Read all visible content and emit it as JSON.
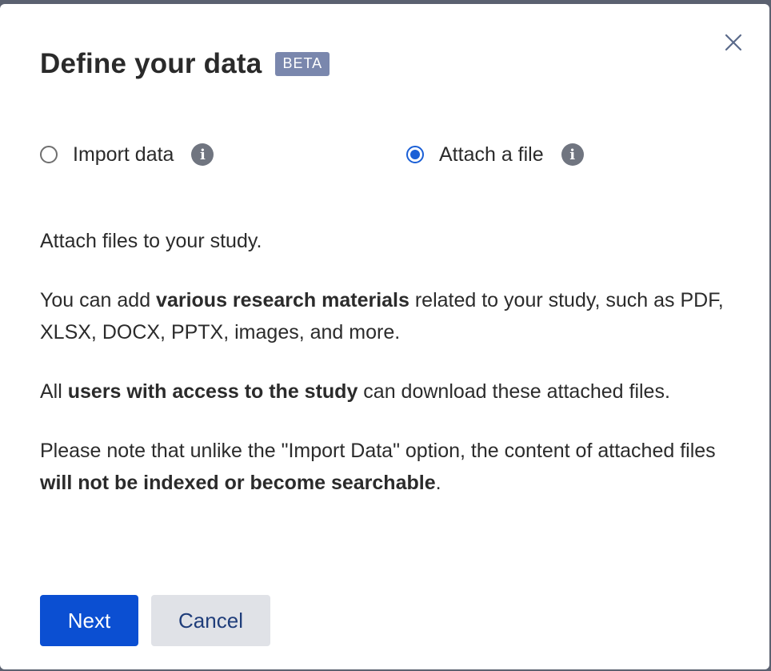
{
  "dialog": {
    "title": "Define your data",
    "badge": "BETA",
    "close_icon": "close-icon"
  },
  "options": {
    "import": {
      "label": "Import data",
      "selected": false,
      "info_icon": "info-icon"
    },
    "attach": {
      "label": "Attach a file",
      "selected": true,
      "info_icon": "info-icon"
    }
  },
  "body": {
    "p1": "Attach files to your study.",
    "p2": {
      "before": "You can add ",
      "bold": "various research materials",
      "after": " related to your study, such as PDF, XLSX, DOCX, PPTX, images, and more."
    },
    "p3": {
      "before": "All ",
      "bold": "users with access to the study",
      "after": " can download these attached files."
    },
    "p4": {
      "before": "Please note that unlike the \"Import Data\" option, the content of attached files ",
      "bold": "will not be indexed or become searchable",
      "after": "."
    }
  },
  "buttons": {
    "next": "Next",
    "cancel": "Cancel"
  },
  "colors": {
    "primary": "#0b4fd2",
    "badge": "#7a87ad",
    "radio_selected": "#1a5fd6"
  }
}
